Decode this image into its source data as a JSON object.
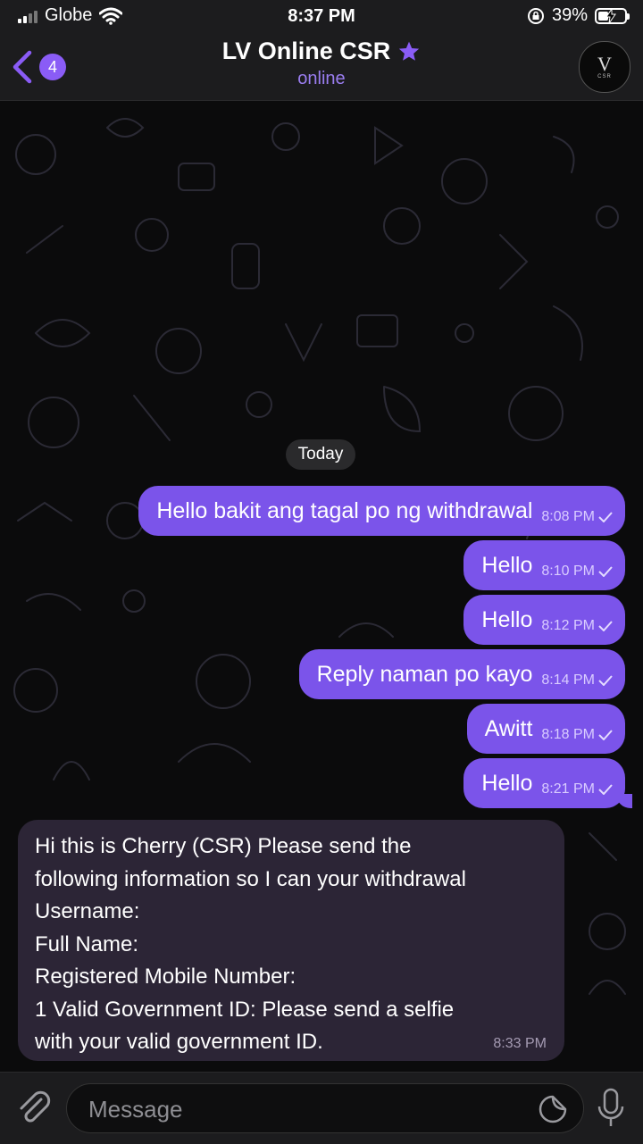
{
  "status_bar": {
    "carrier": "Globe",
    "time": "8:37 PM",
    "battery": "39%",
    "battery_level": 0.39
  },
  "header": {
    "back_count": "4",
    "title": "LV Online CSR",
    "subtitle": "online",
    "avatar_mark": "V",
    "avatar_text": "CSR"
  },
  "chat": {
    "date_label": "Today",
    "outgoing": [
      {
        "text": "Hello bakit ang tagal po ng withdrawal",
        "time": "8:08 PM"
      },
      {
        "text": "Hello",
        "time": "8:10 PM"
      },
      {
        "text": "Hello",
        "time": "8:12 PM"
      },
      {
        "text": "Reply naman po kayo",
        "time": "8:14 PM"
      },
      {
        "text": "Awitt",
        "time": "8:18 PM"
      },
      {
        "text": "Hello",
        "time": "8:21 PM"
      }
    ],
    "incoming": {
      "lines": [
        "Hi this is Cherry (CSR) Please send the",
        "following information so I can your withdrawal",
        "Username:",
        "Full Name:",
        "Registered Mobile Number:",
        "1 Valid Government ID: Please send a selfie",
        "with your valid government ID."
      ],
      "time": "8:33 PM"
    }
  },
  "input": {
    "placeholder": "Message"
  },
  "colors": {
    "accent": "#8a5cf6",
    "outgoing_bubble": "#7b54ea",
    "incoming_bubble": "#2c2536"
  }
}
